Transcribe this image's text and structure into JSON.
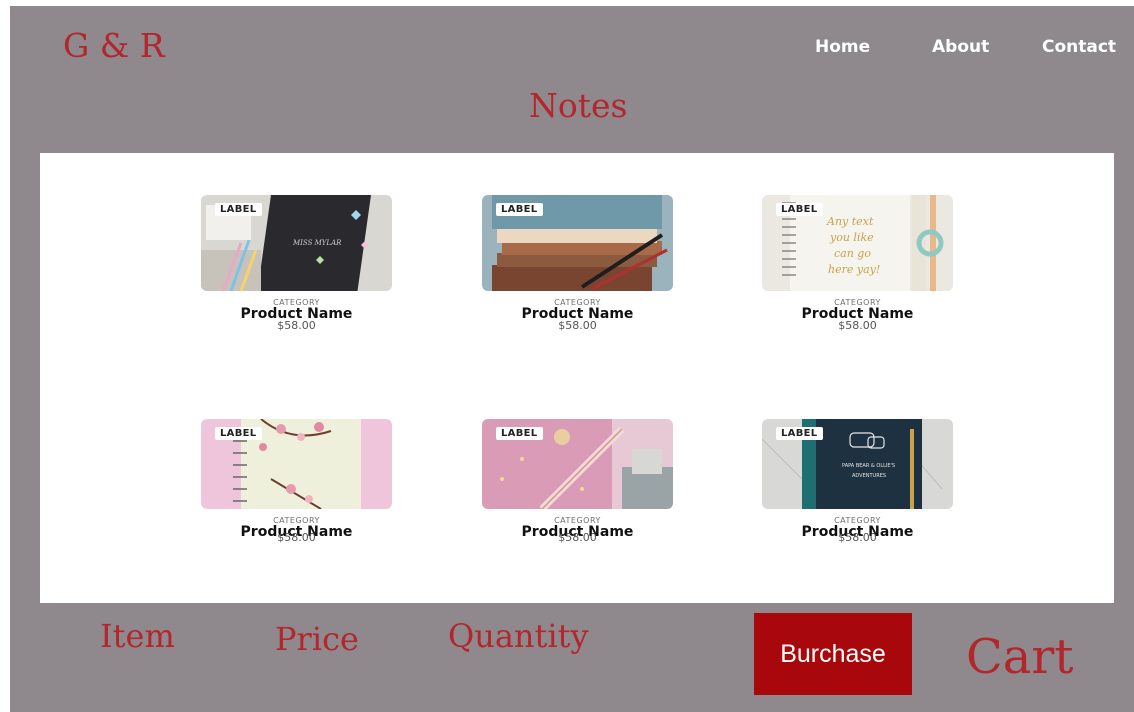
{
  "header": {
    "logo": "G & R",
    "nav": [
      "Home",
      "About",
      "Contact"
    ]
  },
  "page": {
    "heading": "Notes"
  },
  "products": [
    {
      "label": "LABEL",
      "category": "CATEGORY",
      "name": "Product Name",
      "price": "$58.00",
      "image": "black-notebook-butterflies"
    },
    {
      "label": "LABEL",
      "category": "CATEGORY",
      "name": "Product Name",
      "price": "$58.00",
      "image": "stacked-notebooks-pens"
    },
    {
      "label": "LABEL",
      "category": "CATEGORY",
      "name": "Product Name",
      "price": "$58.00",
      "image": "spiral-notebook-gold-text"
    },
    {
      "label": "LABEL",
      "category": "CATEGORY",
      "name": "Product Name",
      "price": "$58.00",
      "image": "pink-blossom-notebook"
    },
    {
      "label": "LABEL",
      "category": "CATEGORY",
      "name": "Product Name",
      "price": "$58.00",
      "image": "pink-planner-pen"
    },
    {
      "label": "LABEL",
      "category": "CATEGORY",
      "name": "Product Name",
      "price": "$58.00",
      "image": "navy-notebook-bears"
    }
  ],
  "footer": {
    "item": "Item",
    "price": "Price",
    "quantity": "Quantity",
    "button": "Burchase",
    "cart": "Cart"
  },
  "colors": {
    "background": "#8f898d",
    "accent": "#b3262b",
    "button": "#a8080c"
  }
}
